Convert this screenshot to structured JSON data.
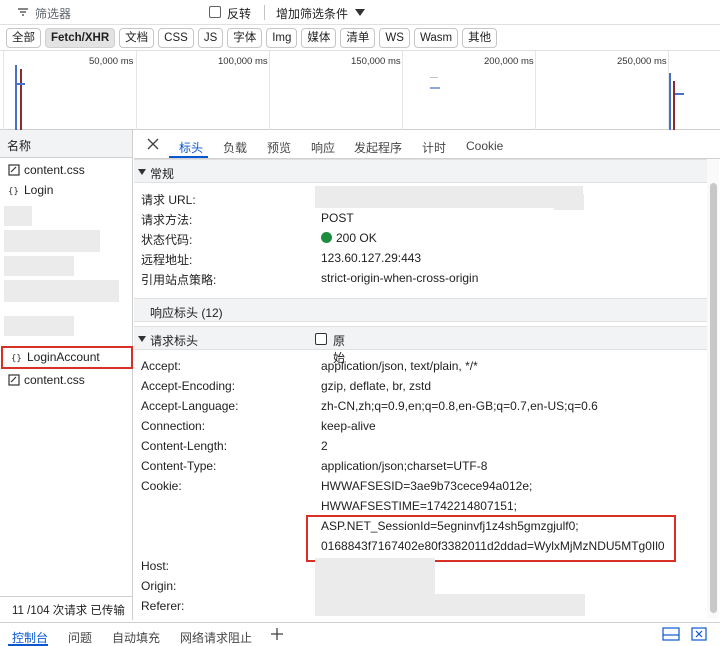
{
  "filter": {
    "icon": "filter-icon",
    "placeholder": "筛选器",
    "invert_label": "反转",
    "add_filter_label": "增加筛选条件"
  },
  "types": [
    "全部",
    "Fetch/XHR",
    "文档",
    "CSS",
    "JS",
    "字体",
    "Img",
    "媒体",
    "清单",
    "WS",
    "Wasm",
    "其他"
  ],
  "active_type": "Fetch/XHR",
  "timeline": {
    "labels": [
      "50,000 ms",
      "100,000 ms",
      "150,000 ms",
      "200,000 ms",
      "250,000 ms"
    ]
  },
  "request_list": {
    "header": "名称",
    "items": [
      {
        "name": "content.css",
        "icon": "css-file-icon"
      },
      {
        "name": "Login",
        "icon": "xhr-icon"
      },
      {
        "name": "LoginAccount",
        "icon": "xhr-icon",
        "highlighted": true
      },
      {
        "name": "content.css",
        "icon": "css-file-icon"
      }
    ],
    "footer": "11 /104 次请求  已传输"
  },
  "detail_tabs": [
    "标头",
    "负载",
    "预览",
    "响应",
    "发起程序",
    "计时",
    "Cookie"
  ],
  "active_detail_tab": "标头",
  "general": {
    "title": "常规",
    "rows": [
      {
        "key": "请求 URL:",
        "value": ""
      },
      {
        "key": "请求方法:",
        "value": "POST"
      },
      {
        "key": "状态代码:",
        "value": "200 OK"
      },
      {
        "key": "远程地址:",
        "value": "123.60.127.29:443"
      },
      {
        "key": "引用站点策略:",
        "value": "strict-origin-when-cross-origin"
      }
    ]
  },
  "response_headers": {
    "title": "响应标头 (12)"
  },
  "request_headers": {
    "title": "请求标头",
    "raw_label": "原始",
    "rows": [
      {
        "key": "Accept:",
        "value": "application/json, text/plain, */*"
      },
      {
        "key": "Accept-Encoding:",
        "value": "gzip, deflate, br, zstd"
      },
      {
        "key": "Accept-Language:",
        "value": "zh-CN,zh;q=0.9,en;q=0.8,en-GB;q=0.7,en-US;q=0.6"
      },
      {
        "key": "Connection:",
        "value": "keep-alive"
      },
      {
        "key": "Content-Length:",
        "value": "2"
      },
      {
        "key": "Content-Type:",
        "value": "application/json;charset=UTF-8"
      },
      {
        "key": "Cookie:",
        "value": "HWWAFSESID=3ae9b73cece94a012e;"
      },
      {
        "key": "",
        "value": "HWWAFSESTIME=1742214807151;"
      },
      {
        "key": "",
        "value": "ASP.NET_SessionId=5egninvfj1z4sh5gmzgjulf0;"
      },
      {
        "key": "",
        "value": "0168843f7167402e80f3382011d2ddad=WylxMjMzNDU5MTg0Il0"
      },
      {
        "key": "Host:",
        "value": ""
      },
      {
        "key": "Origin:",
        "value": ""
      },
      {
        "key": "Referer:",
        "value": ""
      }
    ]
  },
  "drawer_tabs": [
    "控制台",
    "问题",
    "自动填充",
    "网络请求阻止"
  ],
  "colors": {
    "accent": "#0b57d0",
    "highlight": "#d93025",
    "status_ok": "#1e8e3e"
  }
}
